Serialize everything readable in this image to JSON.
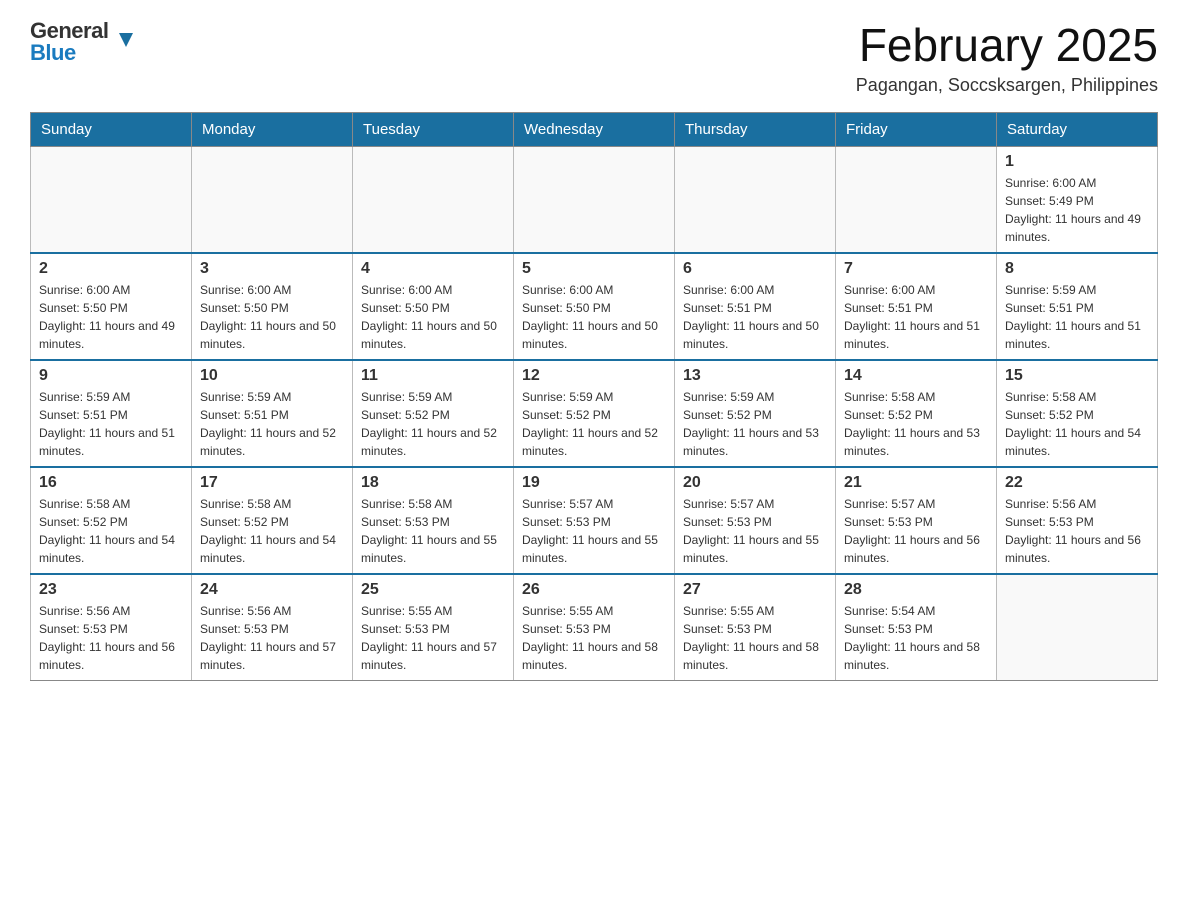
{
  "header": {
    "logo": {
      "general": "General",
      "blue": "Blue",
      "arrow": "▼"
    },
    "title": "February 2025",
    "location": "Pagangan, Soccsksargen, Philippines"
  },
  "days_of_week": [
    "Sunday",
    "Monday",
    "Tuesday",
    "Wednesday",
    "Thursday",
    "Friday",
    "Saturday"
  ],
  "weeks": [
    {
      "days": [
        {
          "number": "",
          "sunrise": "",
          "sunset": "",
          "daylight": "",
          "empty": true
        },
        {
          "number": "",
          "sunrise": "",
          "sunset": "",
          "daylight": "",
          "empty": true
        },
        {
          "number": "",
          "sunrise": "",
          "sunset": "",
          "daylight": "",
          "empty": true
        },
        {
          "number": "",
          "sunrise": "",
          "sunset": "",
          "daylight": "",
          "empty": true
        },
        {
          "number": "",
          "sunrise": "",
          "sunset": "",
          "daylight": "",
          "empty": true
        },
        {
          "number": "",
          "sunrise": "",
          "sunset": "",
          "daylight": "",
          "empty": true
        },
        {
          "number": "1",
          "sunrise": "Sunrise: 6:00 AM",
          "sunset": "Sunset: 5:49 PM",
          "daylight": "Daylight: 11 hours and 49 minutes.",
          "empty": false
        }
      ]
    },
    {
      "days": [
        {
          "number": "2",
          "sunrise": "Sunrise: 6:00 AM",
          "sunset": "Sunset: 5:50 PM",
          "daylight": "Daylight: 11 hours and 49 minutes.",
          "empty": false
        },
        {
          "number": "3",
          "sunrise": "Sunrise: 6:00 AM",
          "sunset": "Sunset: 5:50 PM",
          "daylight": "Daylight: 11 hours and 50 minutes.",
          "empty": false
        },
        {
          "number": "4",
          "sunrise": "Sunrise: 6:00 AM",
          "sunset": "Sunset: 5:50 PM",
          "daylight": "Daylight: 11 hours and 50 minutes.",
          "empty": false
        },
        {
          "number": "5",
          "sunrise": "Sunrise: 6:00 AM",
          "sunset": "Sunset: 5:50 PM",
          "daylight": "Daylight: 11 hours and 50 minutes.",
          "empty": false
        },
        {
          "number": "6",
          "sunrise": "Sunrise: 6:00 AM",
          "sunset": "Sunset: 5:51 PM",
          "daylight": "Daylight: 11 hours and 50 minutes.",
          "empty": false
        },
        {
          "number": "7",
          "sunrise": "Sunrise: 6:00 AM",
          "sunset": "Sunset: 5:51 PM",
          "daylight": "Daylight: 11 hours and 51 minutes.",
          "empty": false
        },
        {
          "number": "8",
          "sunrise": "Sunrise: 5:59 AM",
          "sunset": "Sunset: 5:51 PM",
          "daylight": "Daylight: 11 hours and 51 minutes.",
          "empty": false
        }
      ]
    },
    {
      "days": [
        {
          "number": "9",
          "sunrise": "Sunrise: 5:59 AM",
          "sunset": "Sunset: 5:51 PM",
          "daylight": "Daylight: 11 hours and 51 minutes.",
          "empty": false
        },
        {
          "number": "10",
          "sunrise": "Sunrise: 5:59 AM",
          "sunset": "Sunset: 5:51 PM",
          "daylight": "Daylight: 11 hours and 52 minutes.",
          "empty": false
        },
        {
          "number": "11",
          "sunrise": "Sunrise: 5:59 AM",
          "sunset": "Sunset: 5:52 PM",
          "daylight": "Daylight: 11 hours and 52 minutes.",
          "empty": false
        },
        {
          "number": "12",
          "sunrise": "Sunrise: 5:59 AM",
          "sunset": "Sunset: 5:52 PM",
          "daylight": "Daylight: 11 hours and 52 minutes.",
          "empty": false
        },
        {
          "number": "13",
          "sunrise": "Sunrise: 5:59 AM",
          "sunset": "Sunset: 5:52 PM",
          "daylight": "Daylight: 11 hours and 53 minutes.",
          "empty": false
        },
        {
          "number": "14",
          "sunrise": "Sunrise: 5:58 AM",
          "sunset": "Sunset: 5:52 PM",
          "daylight": "Daylight: 11 hours and 53 minutes.",
          "empty": false
        },
        {
          "number": "15",
          "sunrise": "Sunrise: 5:58 AM",
          "sunset": "Sunset: 5:52 PM",
          "daylight": "Daylight: 11 hours and 54 minutes.",
          "empty": false
        }
      ]
    },
    {
      "days": [
        {
          "number": "16",
          "sunrise": "Sunrise: 5:58 AM",
          "sunset": "Sunset: 5:52 PM",
          "daylight": "Daylight: 11 hours and 54 minutes.",
          "empty": false
        },
        {
          "number": "17",
          "sunrise": "Sunrise: 5:58 AM",
          "sunset": "Sunset: 5:52 PM",
          "daylight": "Daylight: 11 hours and 54 minutes.",
          "empty": false
        },
        {
          "number": "18",
          "sunrise": "Sunrise: 5:58 AM",
          "sunset": "Sunset: 5:53 PM",
          "daylight": "Daylight: 11 hours and 55 minutes.",
          "empty": false
        },
        {
          "number": "19",
          "sunrise": "Sunrise: 5:57 AM",
          "sunset": "Sunset: 5:53 PM",
          "daylight": "Daylight: 11 hours and 55 minutes.",
          "empty": false
        },
        {
          "number": "20",
          "sunrise": "Sunrise: 5:57 AM",
          "sunset": "Sunset: 5:53 PM",
          "daylight": "Daylight: 11 hours and 55 minutes.",
          "empty": false
        },
        {
          "number": "21",
          "sunrise": "Sunrise: 5:57 AM",
          "sunset": "Sunset: 5:53 PM",
          "daylight": "Daylight: 11 hours and 56 minutes.",
          "empty": false
        },
        {
          "number": "22",
          "sunrise": "Sunrise: 5:56 AM",
          "sunset": "Sunset: 5:53 PM",
          "daylight": "Daylight: 11 hours and 56 minutes.",
          "empty": false
        }
      ]
    },
    {
      "days": [
        {
          "number": "23",
          "sunrise": "Sunrise: 5:56 AM",
          "sunset": "Sunset: 5:53 PM",
          "daylight": "Daylight: 11 hours and 56 minutes.",
          "empty": false
        },
        {
          "number": "24",
          "sunrise": "Sunrise: 5:56 AM",
          "sunset": "Sunset: 5:53 PM",
          "daylight": "Daylight: 11 hours and 57 minutes.",
          "empty": false
        },
        {
          "number": "25",
          "sunrise": "Sunrise: 5:55 AM",
          "sunset": "Sunset: 5:53 PM",
          "daylight": "Daylight: 11 hours and 57 minutes.",
          "empty": false
        },
        {
          "number": "26",
          "sunrise": "Sunrise: 5:55 AM",
          "sunset": "Sunset: 5:53 PM",
          "daylight": "Daylight: 11 hours and 58 minutes.",
          "empty": false
        },
        {
          "number": "27",
          "sunrise": "Sunrise: 5:55 AM",
          "sunset": "Sunset: 5:53 PM",
          "daylight": "Daylight: 11 hours and 58 minutes.",
          "empty": false
        },
        {
          "number": "28",
          "sunrise": "Sunrise: 5:54 AM",
          "sunset": "Sunset: 5:53 PM",
          "daylight": "Daylight: 11 hours and 58 minutes.",
          "empty": false
        },
        {
          "number": "",
          "sunrise": "",
          "sunset": "",
          "daylight": "",
          "empty": true
        }
      ]
    }
  ]
}
